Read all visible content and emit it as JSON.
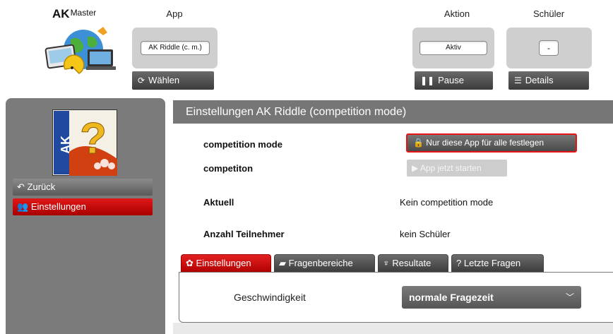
{
  "brand": {
    "bold": "AK",
    "light": "Master"
  },
  "header": {
    "app_title": "App",
    "app_value": "AK Riddle (c. m.)",
    "choose_label": "Wählen",
    "action_title": "Aktion",
    "action_value": "Aktiv",
    "pause_label": "Pause",
    "student_title": "Schüler",
    "student_value": "-",
    "details_label": "Details"
  },
  "sidebar": {
    "items": [
      {
        "label": "Zurück",
        "icon": "back-arrow-icon"
      },
      {
        "label": "Einstellungen",
        "icon": "users-icon"
      }
    ],
    "app_icon_text": "AK"
  },
  "main": {
    "title": "Einstellungen AK Riddle (competition mode)",
    "rows": [
      {
        "label": "competition mode"
      },
      {
        "label": "competiton"
      },
      {
        "label": "Aktuell",
        "value": "Kein competition mode"
      },
      {
        "label": "Anzahl Teilnehmer",
        "value": "kein Schüler"
      }
    ],
    "lock_button": "Nur diese App für alle festlegen",
    "start_button": "App jetzt starten"
  },
  "tabs": [
    {
      "label": "Einstellungen",
      "icon": "gear-icon",
      "active": true
    },
    {
      "label": "Fragenbereiche",
      "icon": "book-icon",
      "active": false
    },
    {
      "label": "Resultate",
      "icon": "trophy-icon",
      "active": false
    },
    {
      "label": "Letzte Fragen",
      "icon": "question-icon",
      "active": false
    }
  ],
  "settings": {
    "speed_label": "Geschwindigkeit",
    "speed_value": "normale Fragezeit"
  },
  "colors": {
    "accent_red": "#cc0000",
    "dark_button": "#4a4a4a",
    "panel_gray": "#cfcfcf"
  }
}
